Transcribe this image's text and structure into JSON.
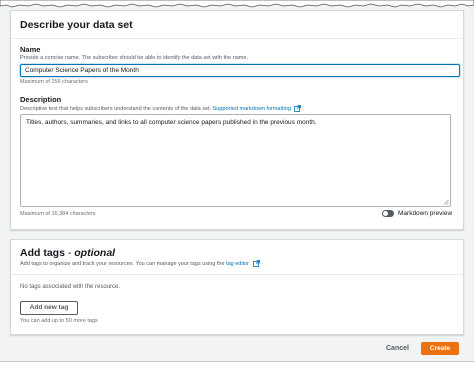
{
  "dataset": {
    "title": "Describe your data set",
    "name_label": "Name",
    "name_desc": "Provide a concise name. The subscriber should be able to identify the data set with the name.",
    "name_value": "Computer Science Papers of the Month",
    "name_hint": "Maximum of 256 characters",
    "description_label": "Description",
    "description_desc": "Descriptive text that helps subscribers understand the contents of the data set.",
    "markdown_link": "Supported markdown formatting",
    "description_value": "Titles, authors, summaries, and links to all computer science papers published in the previous month.",
    "description_hint": "Maximum of 16,384 characters",
    "markdown_preview_label": "Markdown preview",
    "markdown_preview_on": false
  },
  "tags": {
    "title": "Add tags",
    "title_optional": "optional",
    "title_sep": " - ",
    "desc": "Add tags to organize and track your resources. You can manage your tags using the",
    "tag_editor_link": "tag editor",
    "empty_text": "No tags associated with the resource.",
    "add_button": "Add new tag",
    "limit_hint": "You can add up to 50 more tags"
  },
  "footer": {
    "cancel_label": "Cancel",
    "create_label": "Create"
  },
  "colors": {
    "accent": "#0073bb",
    "primary_button": "#ec7211",
    "background": "#f2f3f3"
  }
}
